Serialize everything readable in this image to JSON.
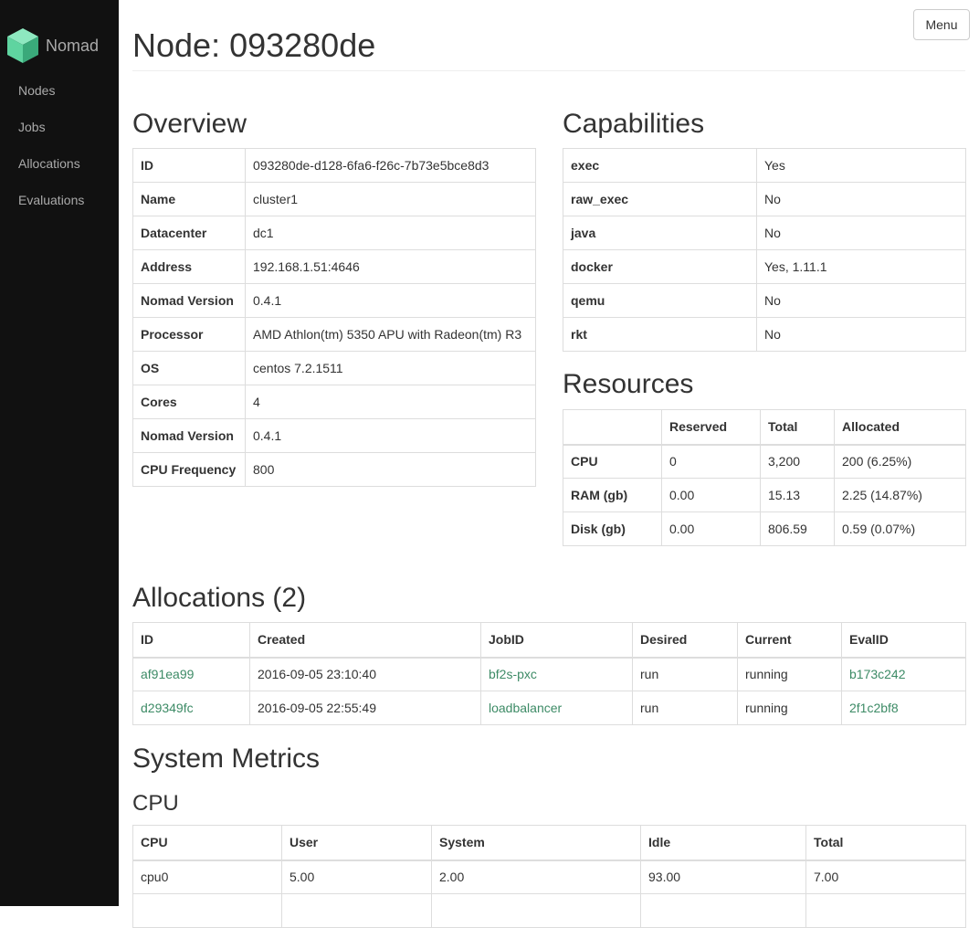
{
  "app": {
    "name": "Nomad"
  },
  "sidebar": {
    "items": [
      {
        "label": "Nodes"
      },
      {
        "label": "Jobs"
      },
      {
        "label": "Allocations"
      },
      {
        "label": "Evaluations"
      }
    ]
  },
  "header": {
    "menu_label": "Menu",
    "title": "Node: 093280de"
  },
  "overview": {
    "heading": "Overview",
    "rows": [
      {
        "key": "ID",
        "value": "093280de-d128-6fa6-f26c-7b73e5bce8d3"
      },
      {
        "key": "Name",
        "value": "cluster1"
      },
      {
        "key": "Datacenter",
        "value": "dc1"
      },
      {
        "key": "Address",
        "value": "192.168.1.51:4646"
      },
      {
        "key": "Nomad Version",
        "value": "0.4.1"
      },
      {
        "key": "Processor",
        "value": "AMD Athlon(tm) 5350 APU with Radeon(tm) R3"
      },
      {
        "key": "OS",
        "value": "centos 7.2.1511"
      },
      {
        "key": "Cores",
        "value": "4"
      },
      {
        "key": "Nomad Version",
        "value": "0.4.1"
      },
      {
        "key": "CPU Frequency",
        "value": "800"
      }
    ]
  },
  "capabilities": {
    "heading": "Capabilities",
    "rows": [
      {
        "key": "exec",
        "value": "Yes"
      },
      {
        "key": "raw_exec",
        "value": "No"
      },
      {
        "key": "java",
        "value": "No"
      },
      {
        "key": "docker",
        "value": "Yes, 1.11.1"
      },
      {
        "key": "qemu",
        "value": "No"
      },
      {
        "key": "rkt",
        "value": "No"
      }
    ]
  },
  "resources": {
    "heading": "Resources",
    "columns": [
      "",
      "Reserved",
      "Total",
      "Allocated"
    ],
    "rows": [
      {
        "key": "CPU",
        "reserved": "0",
        "total": "3,200",
        "allocated": "200 (6.25%)"
      },
      {
        "key": "RAM (gb)",
        "reserved": "0.00",
        "total": "15.13",
        "allocated": "2.25 (14.87%)"
      },
      {
        "key": "Disk (gb)",
        "reserved": "0.00",
        "total": "806.59",
        "allocated": "0.59 (0.07%)"
      }
    ]
  },
  "allocations": {
    "heading": "Allocations (2)",
    "columns": [
      "ID",
      "Created",
      "JobID",
      "Desired",
      "Current",
      "EvalID"
    ],
    "rows": [
      {
        "id": "af91ea99",
        "created": "2016-09-05 23:10:40",
        "job_id": "bf2s-pxc",
        "desired": "run",
        "current": "running",
        "eval_id": "b173c242"
      },
      {
        "id": "d29349fc",
        "created": "2016-09-05 22:55:49",
        "job_id": "loadbalancer",
        "desired": "run",
        "current": "running",
        "eval_id": "2f1c2bf8"
      }
    ]
  },
  "metrics": {
    "heading": "System Metrics",
    "cpu": {
      "heading": "CPU",
      "columns": [
        "CPU",
        "User",
        "System",
        "Idle",
        "Total"
      ],
      "rows": [
        {
          "cpu": "cpu0",
          "user": "5.00",
          "system": "2.00",
          "idle": "93.00",
          "total": "7.00"
        }
      ]
    }
  },
  "colors": {
    "sidebar_bg": "#111111",
    "link": "#3d8b66",
    "logo": "#5fd4a0"
  },
  "icons": {
    "logo": "nomad-logo-icon"
  }
}
